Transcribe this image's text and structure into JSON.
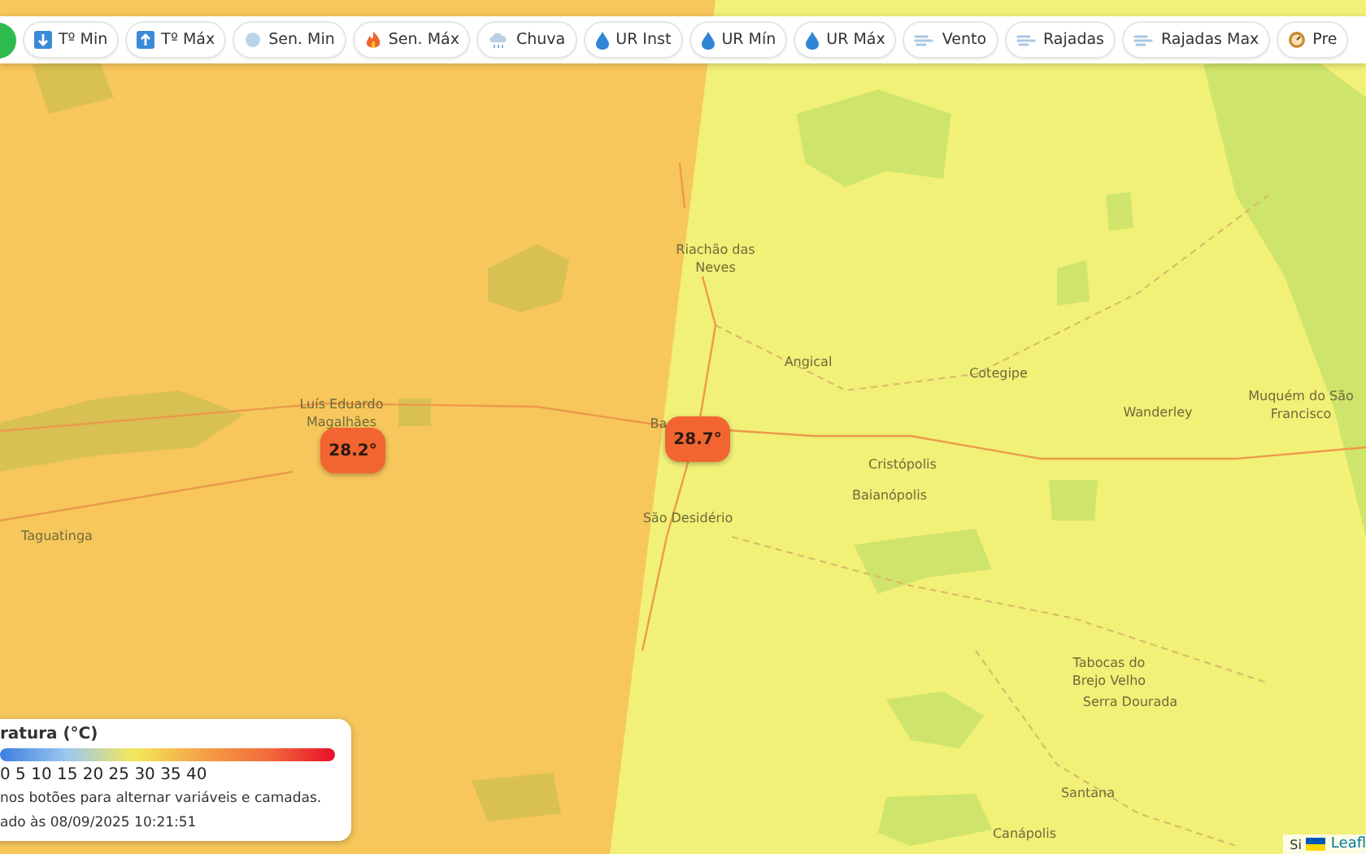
{
  "toolbar": {
    "buttons": [
      {
        "kind": "dot",
        "selected": true
      },
      {
        "kind": "chip",
        "label": "Tº Min",
        "selected": false
      },
      {
        "kind": "chip",
        "label": "Tº Máx",
        "selected": false
      },
      {
        "kind": "chip",
        "label": "Sen. Min",
        "selected": false
      },
      {
        "kind": "chip",
        "label": "Sen. Máx",
        "selected": false
      },
      {
        "kind": "chip",
        "label": "Chuva",
        "selected": false
      },
      {
        "kind": "chip",
        "label": "UR Inst",
        "selected": false
      },
      {
        "kind": "chip",
        "label": "UR Mín",
        "selected": false
      },
      {
        "kind": "chip",
        "label": "UR Máx",
        "selected": false
      },
      {
        "kind": "chip",
        "label": "Vento",
        "selected": false
      },
      {
        "kind": "chip",
        "label": "Rajadas",
        "selected": false
      },
      {
        "kind": "chip",
        "label": "Rajadas Max",
        "selected": false
      },
      {
        "kind": "chip",
        "label": "Pre",
        "selected": false
      }
    ]
  },
  "map": {
    "places": [
      {
        "name": "Riachão das Neves"
      },
      {
        "name": "Luís Eduardo Magalhães"
      },
      {
        "name": "Taguatinga"
      },
      {
        "name": "Ba"
      },
      {
        "name": "São Desidério"
      },
      {
        "name": "Angical"
      },
      {
        "name": "Cotegipe"
      },
      {
        "name": "Wanderley"
      },
      {
        "name": "Muquém do São Francisco"
      },
      {
        "name": "Cristópolis"
      },
      {
        "name": "Baianópolis"
      },
      {
        "name": "Tabocas do Brejo Velho"
      },
      {
        "name": "Serra Dourada"
      },
      {
        "name": "Santana"
      },
      {
        "name": "Canápolis"
      }
    ],
    "markers": [
      {
        "value": "28.2°",
        "color": "#f26430"
      },
      {
        "value": "28.7°",
        "color": "#f26430"
      }
    ]
  },
  "legend": {
    "title": "ratura (°C)",
    "scale": "0 5 10 15 20 25 30 35 40",
    "hint": "nos botões para alternar variáveis e camadas.",
    "updated": "ado às 08/09/2025 10:21:51"
  },
  "attribution": {
    "prefix": "Si",
    "link": "Leafl"
  }
}
